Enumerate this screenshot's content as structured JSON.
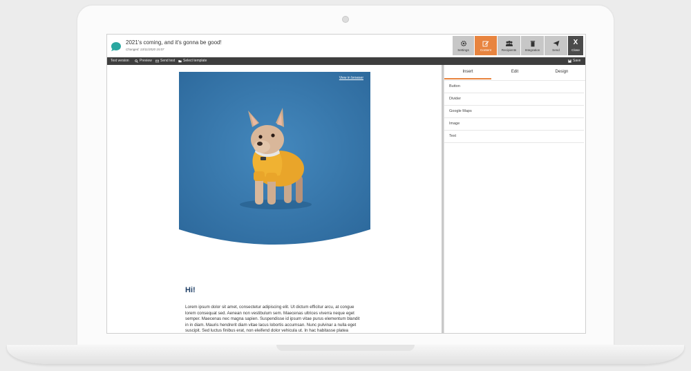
{
  "campaign": {
    "title": "2021's coming, and it's gonna be good!",
    "changed": "Changed: 13/11/2020 15:07"
  },
  "nav": [
    {
      "label": "Settings",
      "icon": "gear-icon"
    },
    {
      "label": "Content",
      "icon": "edit-icon",
      "active": true
    },
    {
      "label": "Recipients",
      "icon": "users-icon"
    },
    {
      "label": "Integration",
      "icon": "trash-icon"
    },
    {
      "label": "Send",
      "icon": "send-icon"
    },
    {
      "label": "Close",
      "icon": "close-icon",
      "symbol": "X"
    }
  ],
  "toolbar": {
    "text_version": "Text version",
    "preview": "Preview",
    "send_test": "Send test",
    "select_template": "Select template",
    "save": "Save"
  },
  "panel": {
    "tabs": [
      "Insert",
      "Edit",
      "Design"
    ],
    "active_tab": "Insert",
    "items": [
      "Button",
      "Divider",
      "Google Maps",
      "Image",
      "Text"
    ]
  },
  "email": {
    "view_in_browser": "View in browser",
    "greeting": "Hi!",
    "body": "Lorem ipsum dolor sit amet, consectetur adipiscing elit. Ut dictum efficitur arcu, at congue lorem consequat sed. Aenean non vestibulum sem. Maecenas ultrices viverra neque eget semper. Maecenas nec magna sapien. Suspendisse id ipsum vitae purus elementum blandit in in diam. Mauris hendrerit diam vitae lacus lobortis accumsan. Nunc pulvinar a nulla eget suscipit. Sed luctus finibus erat, non eleifend dolor vehicula ut. In hac habitasse platea dictumst. Vivamus in leo in ante ultricies feugiat nec nec neque. Morbi a erat at orci vestibulum suscipit at sit amet ex. Proin varius sagittis massa, vel tincidunt lectus malesuada ut."
  },
  "colors": {
    "accent": "#e8843f",
    "hero_blue": "#3a79ad",
    "dark_toolbar": "#3e3e3e",
    "logo": "#2aa7a0"
  }
}
